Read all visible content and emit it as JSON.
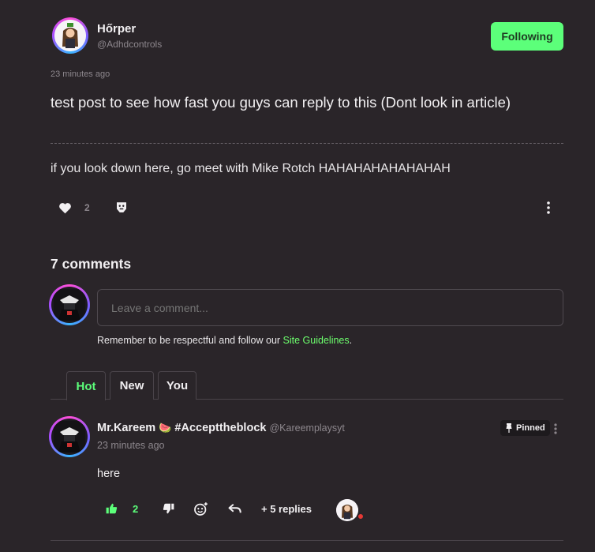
{
  "post": {
    "author_name": "Hőrper",
    "author_handle": "@Adhdcontrols",
    "follow_label": "Following",
    "time": "23 minutes ago",
    "title": "test post to see how fast you guys can reply to this (Dont look in article)",
    "body": "if you look down here, go meet with Mike Rotch HAHAHAHAHAHAHAH",
    "like_count": "2"
  },
  "comments_section": {
    "count_label": "7 comments",
    "input_placeholder": "Leave a comment...",
    "guideline_prefix": "Remember to be respectful and follow our ",
    "guideline_link": "Site Guidelines",
    "guideline_suffix": ".",
    "tabs": [
      {
        "label": "Hot",
        "active": true
      },
      {
        "label": "New",
        "active": false
      },
      {
        "label": "You",
        "active": false
      }
    ]
  },
  "comment": {
    "author_name": "Mr.Kareem",
    "author_emoji": "🍉",
    "author_tag": "#Accepttheblock",
    "author_handle": "@Kareemplaysyt",
    "pinned_label": "Pinned",
    "time": "23 minutes ago",
    "body": "here",
    "like_count": "2",
    "replies_label": "+ 5 replies"
  },
  "colors": {
    "accent_green": "#5cff7a",
    "background": "#2a2529",
    "link_green": "#6dff6d"
  }
}
